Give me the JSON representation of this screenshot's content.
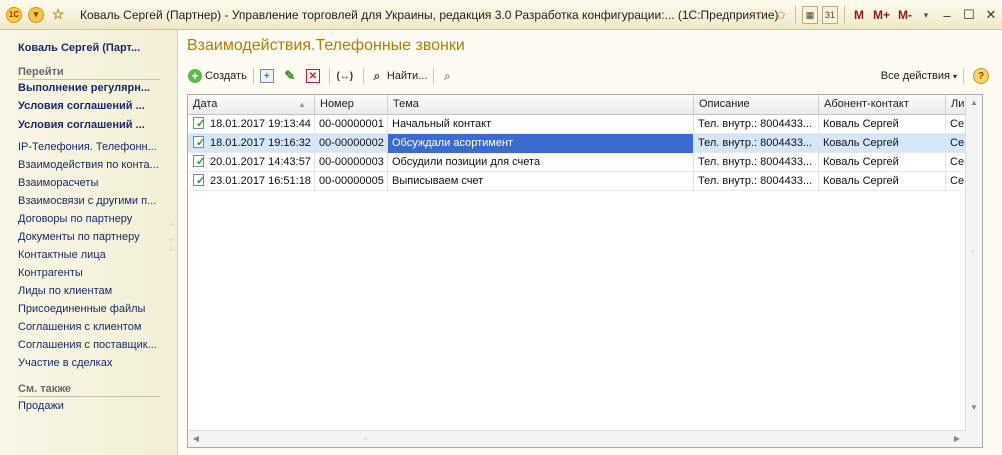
{
  "window": {
    "title": "Коваль Сергей (Партнер) - Управление торговлей для Украины, редакция 3.0 Разработка конфигурации:...  (1С:Предприятие)",
    "memory_buttons": [
      "M",
      "M+",
      "M-"
    ]
  },
  "sidebar": {
    "user": "Коваль Сергей (Парт...",
    "go_header": "Перейти",
    "bold_items": [
      {
        "label": "Выполнение регулярн..."
      },
      {
        "label": "Условия соглашений ..."
      },
      {
        "label": "Условия соглашений ..."
      }
    ],
    "items": [
      {
        "label": "IP-Телефония. Телефонн..."
      },
      {
        "label": "Взаимодействия по конта..."
      },
      {
        "label": "Взаиморасчеты"
      },
      {
        "label": "Взаимосвязи с другими п..."
      },
      {
        "label": "Договоры по партнеру"
      },
      {
        "label": "Документы по партнеру"
      },
      {
        "label": "Контактные лица"
      },
      {
        "label": "Контрагенты"
      },
      {
        "label": "Лиды по клиентам"
      },
      {
        "label": "Присоединенные файлы"
      },
      {
        "label": "Соглашения с клиентом"
      },
      {
        "label": "Соглашения с поставщик..."
      },
      {
        "label": "Участие в сделках"
      }
    ],
    "see_also_header": "См. также",
    "see_also_items": [
      {
        "label": "Продажи"
      }
    ]
  },
  "main": {
    "title": "Взаимодействия.Телефонные звонки",
    "toolbar": {
      "create_label": "Создать",
      "find_label": "Найти...",
      "all_actions_label": "Все действия",
      "arrows_glyph": "(↔)"
    },
    "grid": {
      "columns": [
        "Дата",
        "Номер",
        "Тема",
        "Описание",
        "Абонент-контакт",
        "Ли"
      ],
      "rows": [
        {
          "date": "18.01.2017 19:13:44",
          "number": "00-00000001",
          "subject": "Начальный контакт",
          "description": "Тел. внутр.: 8004433...",
          "contact": "Коваль Сергей",
          "extra": "Се"
        },
        {
          "date": "18.01.2017 19:16:32",
          "number": "00-00000002",
          "subject": "Обсуждали асортимент",
          "description": "Тел. внутр.: 8004433...",
          "contact": "Коваль Сергей",
          "extra": "Се"
        },
        {
          "date": "20.01.2017 14:43:57",
          "number": "00-00000003",
          "subject": "Обсудили позиции для счета",
          "description": "Тел. внутр.: 8004433...",
          "contact": "Коваль Сергей",
          "extra": "Се"
        },
        {
          "date": "23.01.2017 16:51:18",
          "number": "00-00000005",
          "subject": "Выписываем счет",
          "description": "Тел. внутр.: 8004433...",
          "contact": "Коваль Сергей",
          "extra": "Се"
        }
      ],
      "selected_row": 1
    }
  },
  "colors": {
    "accent_title": "#b07c0b",
    "link": "#1a2a6a",
    "selection": "#d6e6f9",
    "focus_cell": "#3a6ccf"
  }
}
